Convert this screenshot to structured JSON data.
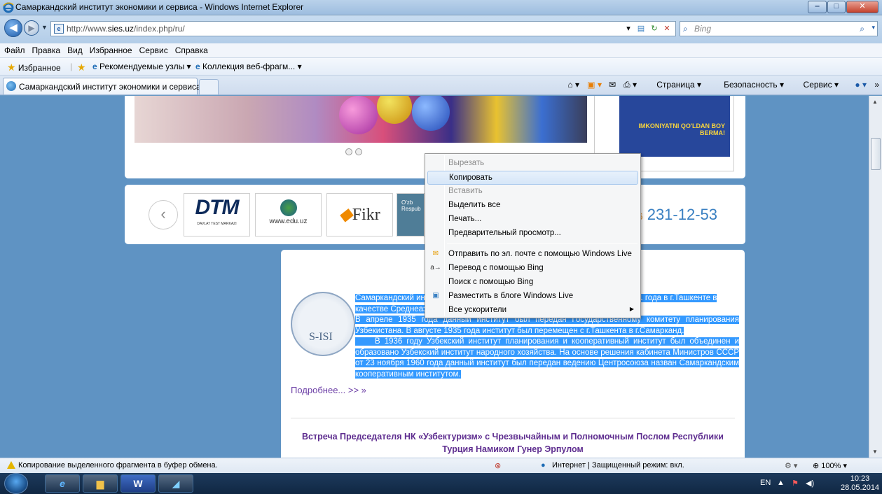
{
  "window": {
    "title": "Самаркандский институт экономики и сервиса - Windows Internet Explorer",
    "min_label": "‒",
    "max_label": "□",
    "close_label": "✕"
  },
  "addressbar": {
    "url_prefix": "http://www.",
    "url_domain": "sies.uz",
    "url_suffix": "/index.php/ru/",
    "search_placeholder": "Bing"
  },
  "menubar": {
    "items": [
      "Файл",
      "Правка",
      "Вид",
      "Избранное",
      "Сервис",
      "Справка"
    ]
  },
  "favbar": {
    "favorites_label": "Избранное",
    "suggested_label": "Рекомендуемые узлы ▾",
    "gallery_label": "Коллекция веб-фрагм... ▾"
  },
  "tabs": {
    "active_label": "Самаркандский институт экономики и сервиса"
  },
  "commandbar": {
    "page_label": "Страница ▾",
    "safety_label": "Безопасность ▾",
    "tools_label": "Сервис ▾"
  },
  "content": {
    "poster_big": "IMKONIYATNI QO'LDAN BOY BERMA!",
    "logos": {
      "dtm": "DTM",
      "dtm_sub": "DAVLAT TEST MARKAZI",
      "edu": "www.edu.uz",
      "fikr": "Fikr",
      "oz": "O'zb Respub"
    },
    "phone_prefix": "66",
    "phone": "231-12-53",
    "paragraph_parts": [
      "Самаркандский ин",
      "31 года в г.Ташкенте в",
      "качестве Среднеаз",
      "В апреле 1935 года данный институт был передан Государственному комитету планирования Узбекистана. В августе 1935 года институт был перемещен с г.Ташкента в г.Самарканд.",
      "В 1936 году Узбекский институт планирования и кооперативный институт был объединен и образовано Узбекский институт народного хозяйства. На основе решения кабинета Министров СССР от 23 ноября 1960 года данный институт был передан ведению Центросоюза назван Самаркандским кооперативным институтом."
    ],
    "emblem_text": "S-ISI",
    "more_link": "Подробнее... >> »",
    "news_title": "Встреча Председателя НК «Узбектуризм» с Чрезвычайным и Полномочным Послом Республики Турция Намиком Гунер Эрпулом"
  },
  "context_menu": {
    "items": [
      {
        "label": "Вырезать",
        "disabled": true
      },
      {
        "label": "Копировать",
        "disabled": false,
        "hover": true
      },
      {
        "label": "Вставить",
        "disabled": true
      },
      {
        "label": "Выделить все",
        "disabled": false
      },
      {
        "label": "Печать...",
        "disabled": false
      },
      {
        "label": "Предварительный просмотр...",
        "disabled": false
      },
      {
        "label": "Отправить по эл. почте с помощью Windows Live",
        "disabled": false
      },
      {
        "label": "Перевод с помощью Bing",
        "disabled": false
      },
      {
        "label": "Поиск с помощью Bing",
        "disabled": false
      },
      {
        "label": "Разместить в блоге Windows Live",
        "disabled": false
      },
      {
        "label": "Все ускорители",
        "disabled": false
      }
    ]
  },
  "statusbar": {
    "message": "Копирование выделенного фрагмента в буфер обмена.",
    "zone": "Интернет | Защищенный режим: вкл.",
    "zoom": "100%"
  },
  "taskbar": {
    "lang": "EN",
    "time": "10:23",
    "date": "28.05.2014",
    "word_label": "W"
  },
  "colors": {
    "selection": "#3399ff",
    "page_background": "#5f93c3",
    "link_purple": "#6c3fa6"
  }
}
